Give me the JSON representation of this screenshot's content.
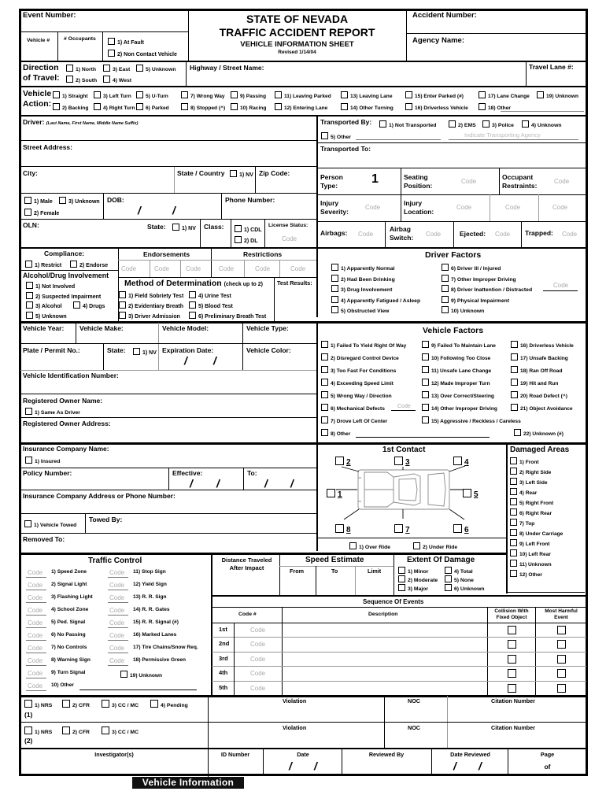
{
  "header": {
    "event_number": "Event Number:",
    "vehicle_num": "Vehicle #",
    "occupants": "# Occupants",
    "at_fault": "1) At Fault",
    "non_contact": "2) Non Contact Vehicle",
    "title1": "STATE OF NEVADA",
    "title2": "TRAFFIC ACCIDENT REPORT",
    "title3": "VEHICLE INFORMATION SHEET",
    "revised": "Revised 1/14/04",
    "accident_number": "Accident Number:",
    "agency_name": "Agency Name:"
  },
  "direction": {
    "label1": "Direction",
    "label2": "of Travel:",
    "options": [
      "1) North",
      "3) East",
      "5) Unknown",
      "2) South",
      "4) West"
    ],
    "highway": "Highway / Street Name:",
    "travel_lane": "Travel Lane #:"
  },
  "vehicle_action": {
    "label1": "Vehicle",
    "label2": "Action:",
    "row1": [
      "1) Straight",
      "3) Left Turn",
      "5) U-Turn",
      "7) Wrong Way",
      "9) Passing",
      "11) Leaving Parked",
      "13) Leaving Lane",
      "15) Enter Parked (#)",
      "17) Lane Change",
      "19) Unknown"
    ],
    "row2": [
      "2) Backing",
      "4) Right Turn",
      "6) Parked",
      "8) Stopped (^)",
      "10) Racing",
      "12) Entering Lane",
      "14) Other Turning",
      "16) Driverless Vehicle",
      "18) Other"
    ]
  },
  "driver": {
    "driver_label": "Driver:",
    "driver_hint": "(Last Name, First Name, Middle Name   Suffix)",
    "street": "Street Address:",
    "city": "City:",
    "state_country": "State / Country",
    "nv": "1) NV",
    "zip": "Zip Code:",
    "male": "1) Male",
    "unknown": "3) Unknown",
    "female": "2) Female",
    "dob": "DOB:",
    "phone": "Phone Number:",
    "oln": "OLN:",
    "state": "State:",
    "class": "Class:",
    "cdl": "1) CDL",
    "dl": "2) DL",
    "license_status": "License Status:",
    "code": "Code"
  },
  "transport": {
    "by": "Transported By:",
    "options": [
      "1) Not Transported",
      "2) EMS",
      "3) Police",
      "4) Unknown",
      "5) Other"
    ],
    "agency_hint": "Indicate Transporting Agency",
    "to": "Transported To:",
    "person_type": "Person Type:",
    "person_type_value": "1",
    "seating": "Seating Position:",
    "restraints": "Occupant Restraints:",
    "injury_severity": "Injury Severity:",
    "injury_location": "Injury Location:",
    "airbags": "Airbags:",
    "airbag_switch": "Airbag Switch:",
    "ejected": "Ejected:",
    "trapped": "Trapped:"
  },
  "compliance": {
    "title": "Compliance:",
    "restrict": "1) Restrict",
    "endorse": "2) Endorse",
    "endorsements": "Endorsements",
    "restrictions": "Restrictions",
    "alcohol_title": "Alcohol/Drug Involvement",
    "alcohol_options": [
      "1) Not Involved",
      "2) Suspected Impairment",
      "3) Alcohol",
      "4) Drugs",
      "5) Unknown"
    ],
    "method_title": "Method of Determination",
    "method_hint": "(check up to 2)",
    "method_options": [
      "1) Field Sobriety Test",
      "4) Urine Test",
      "2) Evidentiary Breath",
      "5) Blood Test",
      "3) Driver Admission",
      "6) Preliminary Breath Test"
    ],
    "test_results": "Test Results:"
  },
  "driver_factors": {
    "title": "Driver Factors",
    "left": [
      "1) Apparently Normal",
      "2) Had Been Drinking",
      "3) Drug Involvement",
      "4) Apparently Fatigued / Asleep",
      "5) Obstructed View"
    ],
    "right": [
      "6) Driver Ill / Injured",
      "7) Other Improper Driving",
      "8) Driver Inattention / Distracted",
      "9) Physical Impairment",
      "10) Unknown"
    ]
  },
  "vehicle": {
    "year": "Vehicle Year:",
    "make": "Vehicle Make:",
    "model": "Vehicle Model:",
    "type": "Vehicle Type:",
    "plate": "Plate / Permit No.:",
    "state": "State:",
    "nv": "1) NV",
    "expiration": "Expiration Date:",
    "color": "Vehicle Color:",
    "vin": "Vehicle Identification Number:",
    "owner": "Registered Owner Name:",
    "same_as_driver": "1) Same As Driver",
    "owner_address": "Registered Owner Address:"
  },
  "vehicle_factors": {
    "title": "Vehicle Factors",
    "col1": [
      "1) Failed To Yield Right Of Way",
      "2) Disregard Control Device",
      "3) Too Fast For Conditions",
      "4) Exceeding Speed Limit",
      "5) Wrong Way / Direction",
      "6) Mechanical Defects",
      "7) Drove Left Of Center",
      "8) Other"
    ],
    "col2": [
      "9) Failed To Maintain Lane",
      "10) Following Too Close",
      "11) Unsafe Lane Change",
      "12) Made Improper Turn",
      "13) Over Correct/Steering",
      "14) Other Improper Driving",
      "15) Aggressive / Reckless / Careless"
    ],
    "col3": [
      "16) Driverless Vehicle",
      "17) Unsafe Backing",
      "18) Ran Off Road",
      "19) Hit and Run",
      "20) Road Defect (^)",
      "21) Object Avoidance",
      "22) Unknown (#)"
    ]
  },
  "insurance": {
    "company": "Insurance Company Name:",
    "insured": "1) Insured",
    "policy": "Policy Number:",
    "effective": "Effective:",
    "to": "To:",
    "address": "Insurance Company Address or Phone Number:",
    "towed": "1) Vehicle Towed",
    "towed_by": "Towed By:",
    "removed_to": "Removed To:"
  },
  "contact": {
    "title": "1st Contact",
    "points": [
      "1",
      "2",
      "3",
      "4",
      "5",
      "6",
      "7",
      "8"
    ],
    "over_ride": "1) Over Ride",
    "under_ride": "2) Under Ride"
  },
  "damaged_areas": {
    "title": "Damaged Areas",
    "items": [
      "1) Front",
      "2) Right Side",
      "3) Left Side",
      "4) Rear",
      "5) Right Front",
      "6) Right Rear",
      "7) Top",
      "8) Under Carriage",
      "9) Left Front",
      "10) Left Rear",
      "11) Unknown",
      "12) Other"
    ]
  },
  "traffic_control": {
    "title": "Traffic Control",
    "left": [
      "1) Speed Zone",
      "2) Signal Light",
      "3) Flashing Light",
      "4) School Zone",
      "5) Ped. Signal",
      "6) No Passing",
      "7) No Controls",
      "8) Warning Sign",
      "9) Turn Signal",
      "10) Other"
    ],
    "right": [
      "11) Stop Sign",
      "12) Yield Sign",
      "13) R. R. Sign",
      "14) R. R. Gates",
      "15) R. R. Signal (#)",
      "16) Marked Lanes",
      "17) Tire Chains/Snow Req.",
      "18) Permissive Green",
      "19) Unknown"
    ]
  },
  "speed": {
    "distance": "Distance Traveled",
    "after_impact": "After Impact",
    "title": "Speed Estimate",
    "from": "From",
    "to": "To",
    "limit": "Limit"
  },
  "extent": {
    "title": "Extent Of Damage",
    "options": [
      "1) Minor",
      "4) Total",
      "2) Moderate",
      "5) None",
      "3) Major",
      "6) Unknown"
    ]
  },
  "sequence": {
    "title": "Sequence Of Events",
    "code_header": "Code #",
    "description": "Description",
    "collision": "Collision With Fixed Object",
    "collision1": "Collision With",
    "collision2": "Fixed Object",
    "harmful1": "Most Harmful",
    "harmful2": "Event",
    "rows": [
      "1st",
      "2nd",
      "3rd",
      "4th",
      "5th"
    ]
  },
  "citations": {
    "row1_options": [
      "1) NRS",
      "2) CFR",
      "3) CC / MC",
      "4) Pending"
    ],
    "row1_num": "(1)",
    "row2_options": [
      "1) NRS",
      "2) CFR",
      "3) CC / MC"
    ],
    "row2_num": "(2)",
    "violation": "Violation",
    "noc": "NOC",
    "citation_number": "Citation Number"
  },
  "footer": {
    "investigators": "Investigator(s)",
    "id_number": "ID Number",
    "date": "Date",
    "reviewed_by": "Reviewed By",
    "date_reviewed": "Date Reviewed",
    "page": "Page",
    "of": "of",
    "banner": "Vehicle Information"
  },
  "common": {
    "slash": "/",
    "code": "Code"
  }
}
